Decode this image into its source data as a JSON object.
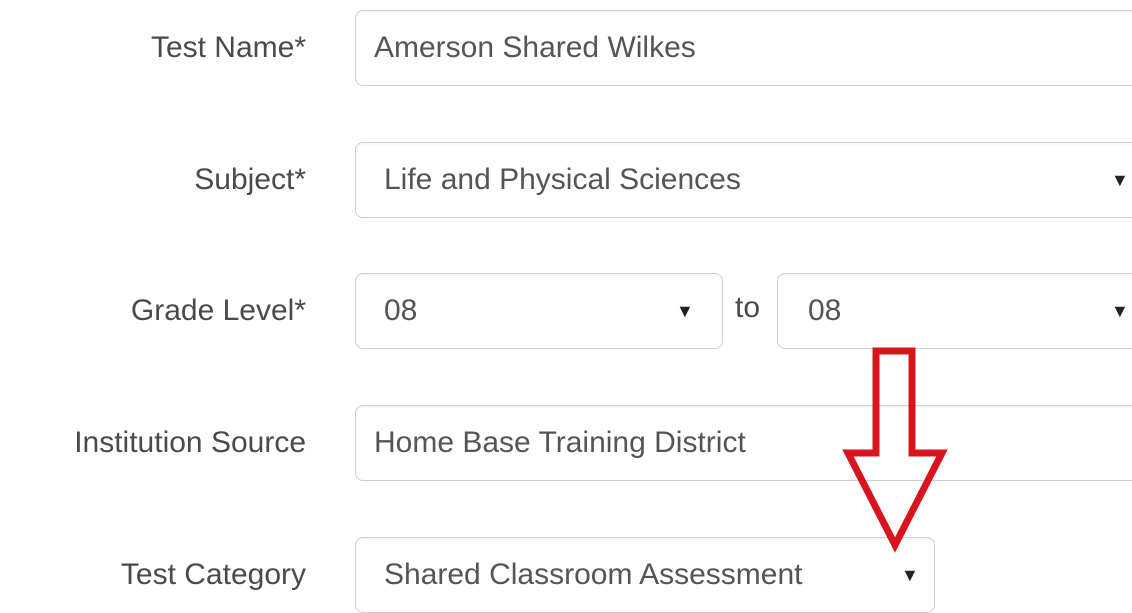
{
  "form": {
    "test_name": {
      "label": "Test Name*",
      "value": "Amerson Shared Wilkes"
    },
    "subject": {
      "label": "Subject*",
      "value": "Life and Physical Sciences"
    },
    "grade_level": {
      "label": "Grade Level*",
      "from_value": "08",
      "to_label": "to",
      "to_value": "08"
    },
    "institution_source": {
      "label": "Institution Source",
      "value": "Home Base Training District"
    },
    "test_category": {
      "label": "Test Category",
      "value": "Shared Classroom Assessment"
    }
  },
  "annotation": {
    "arrow_color": "#d8141c",
    "arrow_direction": "down"
  },
  "icons": {
    "caret": "▼"
  }
}
